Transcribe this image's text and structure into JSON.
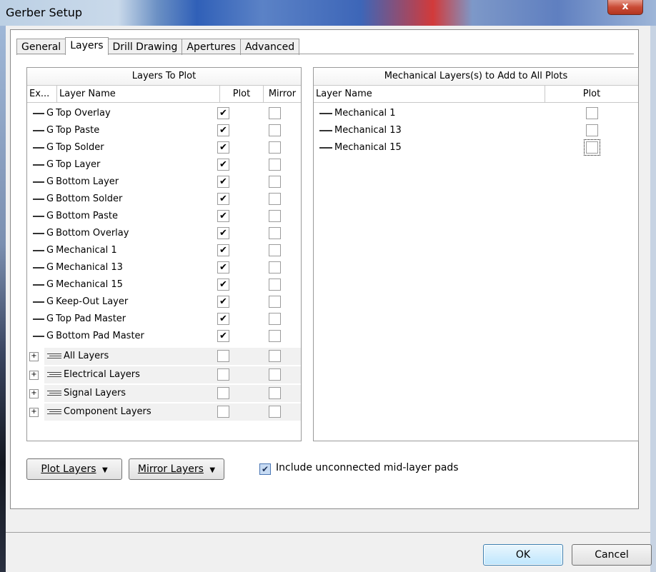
{
  "window": {
    "title": "Gerber Setup",
    "close_label": "x"
  },
  "tabs": [
    "General",
    "Layers",
    "Drill Drawing",
    "Apertures",
    "Advanced"
  ],
  "left_panel": {
    "title": "Layers To Plot",
    "col_ext": "Ex...",
    "col_name": "Layer Name",
    "col_plot": "Plot",
    "col_mirror": "Mirror",
    "layer_prefix": "G",
    "layers": [
      {
        "name": "Top Overlay",
        "plot": true,
        "mirror": false
      },
      {
        "name": "Top Paste",
        "plot": true,
        "mirror": false
      },
      {
        "name": "Top Solder",
        "plot": true,
        "mirror": false
      },
      {
        "name": "Top Layer",
        "plot": true,
        "mirror": false
      },
      {
        "name": "Bottom Layer",
        "plot": true,
        "mirror": false
      },
      {
        "name": "Bottom Solder",
        "plot": true,
        "mirror": false
      },
      {
        "name": "Bottom Paste",
        "plot": true,
        "mirror": false
      },
      {
        "name": "Bottom Overlay",
        "plot": true,
        "mirror": false
      },
      {
        "name": "Mechanical 1",
        "plot": true,
        "mirror": false
      },
      {
        "name": "Mechanical 13",
        "plot": true,
        "mirror": false
      },
      {
        "name": "Mechanical 15",
        "plot": true,
        "mirror": false
      },
      {
        "name": "Keep-Out Layer",
        "plot": true,
        "mirror": false
      },
      {
        "name": "Top Pad Master",
        "plot": true,
        "mirror": false
      },
      {
        "name": "Bottom Pad Master",
        "plot": true,
        "mirror": false
      }
    ],
    "groups": [
      {
        "name": "All Layers",
        "expand": "+"
      },
      {
        "name": "Electrical Layers",
        "expand": "+"
      },
      {
        "name": "Signal Layers",
        "expand": "+"
      },
      {
        "name": "Component Layers",
        "expand": "+"
      }
    ]
  },
  "right_panel": {
    "title": "Mechanical Layers(s) to Add to All Plots",
    "col_name": "Layer Name",
    "col_plot": "Plot",
    "layers": [
      {
        "name": "Mechanical 1",
        "plot": false
      },
      {
        "name": "Mechanical 13",
        "plot": false
      },
      {
        "name": "Mechanical 15",
        "plot": false
      }
    ]
  },
  "buttons": {
    "plot_layers": "Plot Layers",
    "mirror_layers": "Mirror Layers",
    "dropdown_arrow": "▼",
    "include_unconnected": "Include unconnected mid-layer pads",
    "include_unconnected_checked": true,
    "ok": "OK",
    "cancel": "Cancel"
  }
}
